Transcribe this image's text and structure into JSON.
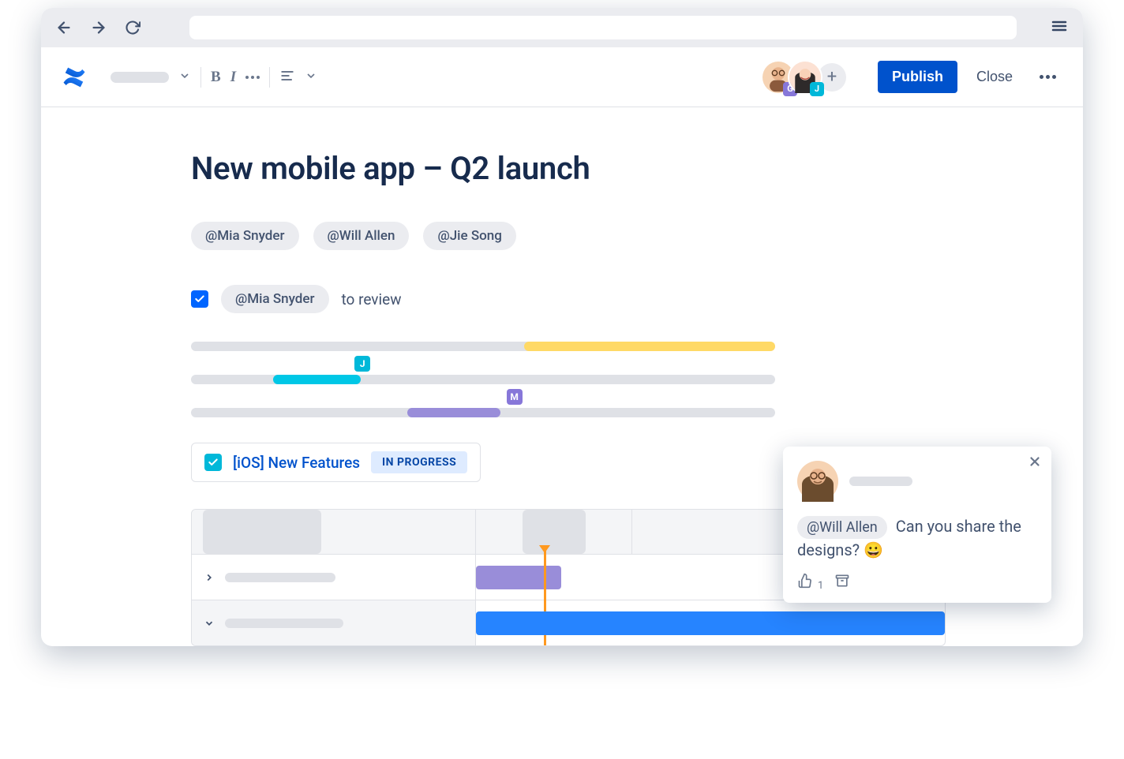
{
  "colors": {
    "brand_blue": "#0052CC",
    "yellow": "#FFD966",
    "teal": "#00C7E6",
    "purple": "#998DD9",
    "orange": "#FF991F",
    "gantt_blue": "#2684FF"
  },
  "toolbar": {
    "publish_label": "Publish",
    "close_label": "Close",
    "add_person_label": "+"
  },
  "avatars": {
    "g_badge": "G",
    "g_badge_color": "#8777D9",
    "j_badge": "J",
    "j_badge_color": "#00B8D9"
  },
  "page": {
    "title": "New mobile app – Q2 launch",
    "mentions": [
      "@Mia Snyder",
      "@Will Allen",
      "@Jie Song"
    ],
    "task": {
      "checked": true,
      "assignee_mention": "@Mia Snyder",
      "text": "to review"
    },
    "timeline_tags": {
      "j": "J",
      "m": "M"
    },
    "issue": {
      "title": "[iOS] New Features",
      "status": "IN PROGRESS"
    }
  },
  "comment": {
    "mention": "@Will Allen",
    "text_after": "Can you share the designs?  😀",
    "like_count": "1"
  }
}
